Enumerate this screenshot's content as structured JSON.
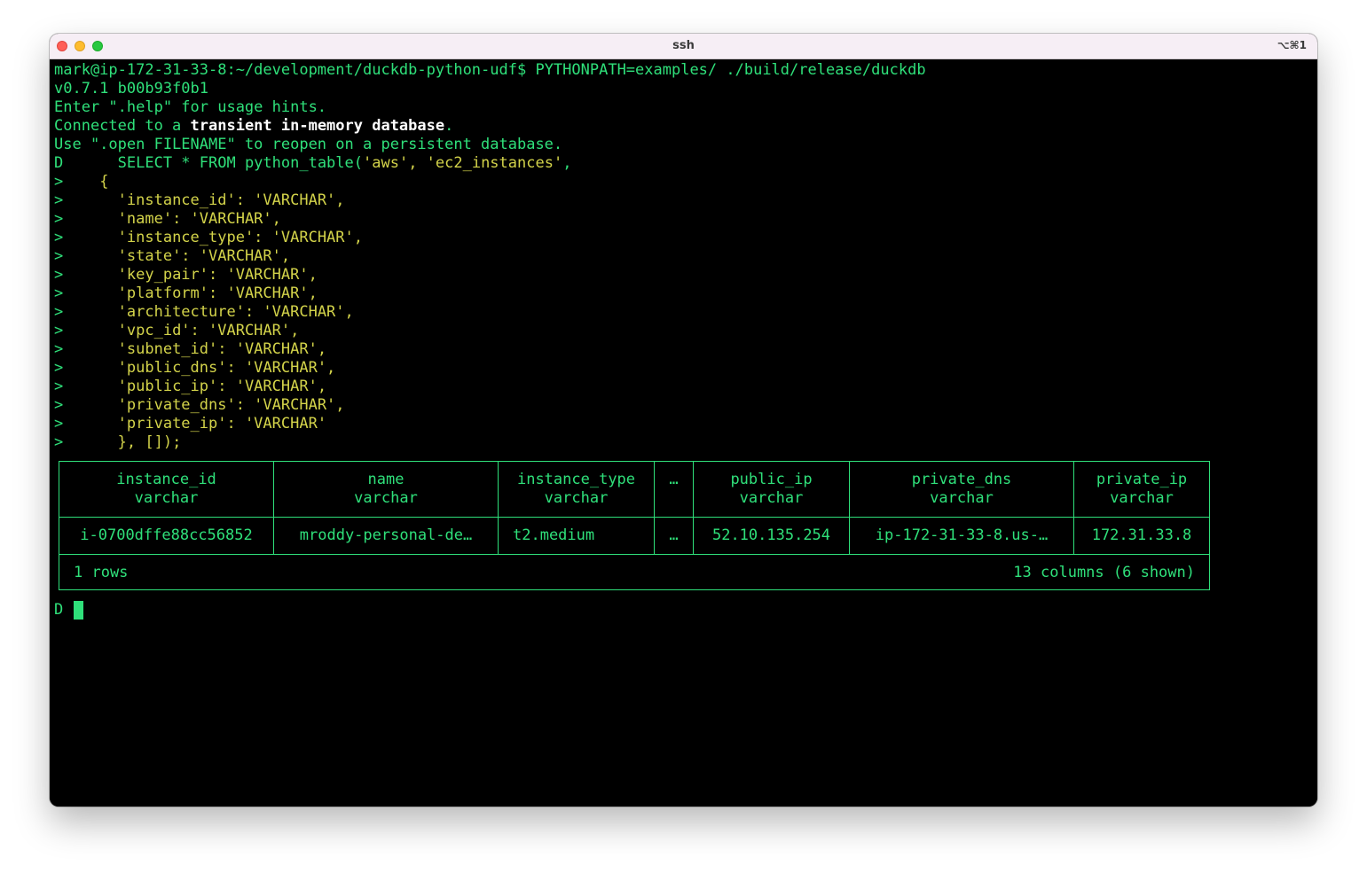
{
  "window": {
    "title": "ssh",
    "shortcut": "⌥⌘1"
  },
  "terminal": {
    "command": {
      "prompt": "mark@ip-172-31-33-8:~/development/duckdb-python-udf$ ",
      "text": "PYTHONPATH=examples/ ./build/release/duckdb"
    },
    "version": "v0.7.1 b00b93f0b1",
    "help_hint": "Enter \".help\" for usage hints.",
    "connected": {
      "prefix": "Connected to a ",
      "bold": "transient in-memory database",
      "suffix": "."
    },
    "open_hint": "Use \".open FILENAME\" to reopen on a persistent database.",
    "query": {
      "first_prompt": "D",
      "first_code": "      SELECT * FROM python_table(",
      "first_args": "'aws', 'ec2_instances'",
      "first_end": ",",
      "cont_prompt": ">",
      "lines": [
        "    {",
        "      'instance_id': 'VARCHAR',",
        "      'name': 'VARCHAR',",
        "      'instance_type': 'VARCHAR',",
        "      'state': 'VARCHAR',",
        "      'key_pair': 'VARCHAR',",
        "      'platform': 'VARCHAR',",
        "      'architecture': 'VARCHAR',",
        "      'vpc_id': 'VARCHAR',",
        "      'subnet_id': 'VARCHAR',",
        "      'public_dns': 'VARCHAR',",
        "      'public_ip': 'VARCHAR',",
        "      'private_dns': 'VARCHAR',",
        "      'private_ip': 'VARCHAR'",
        "      }, []);"
      ]
    },
    "result": {
      "columns": [
        {
          "name": "instance_id",
          "type": "varchar"
        },
        {
          "name": "name",
          "type": "varchar"
        },
        {
          "name": "instance_type",
          "type": "varchar"
        },
        {
          "name": "…",
          "type": ""
        },
        {
          "name": "public_ip",
          "type": "varchar"
        },
        {
          "name": "private_dns",
          "type": "varchar"
        },
        {
          "name": "private_ip",
          "type": "varchar"
        }
      ],
      "rows": [
        [
          "i-0700dffe88cc56852",
          "mroddy-personal-de…",
          "t2.medium",
          "…",
          "52.10.135.254",
          "ip-172-31-33-8.us-…",
          "172.31.33.8"
        ]
      ],
      "row_count": "1 rows",
      "column_summary": "13 columns (6 shown)"
    },
    "final_prompt": "D"
  }
}
